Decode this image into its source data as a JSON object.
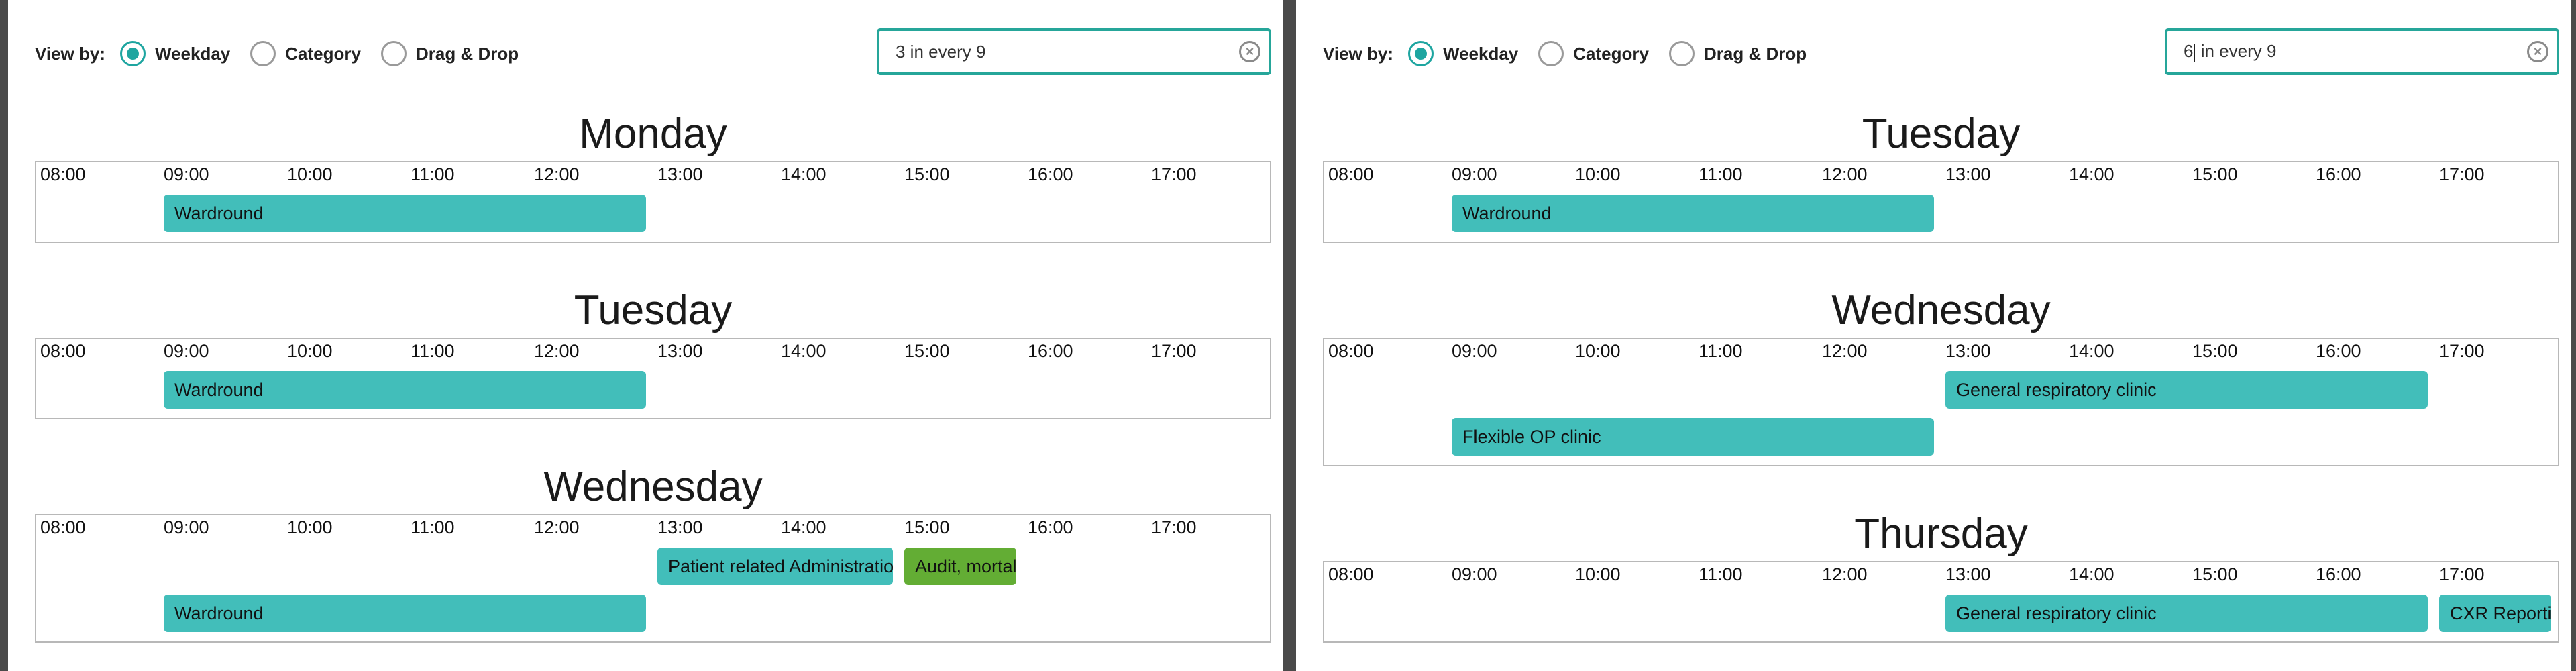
{
  "panels": [
    {
      "view_by_label": "View by:",
      "view_options": [
        "Weekday",
        "Category",
        "Drag & Drop"
      ],
      "search_value": "3 in every 9",
      "clear_icon": "clear-icon",
      "hours": [
        "08:00",
        "09:00",
        "10:00",
        "11:00",
        "12:00",
        "13:00",
        "14:00",
        "15:00",
        "16:00",
        "17:00"
      ],
      "days": [
        {
          "name": "Monday",
          "events": [
            {
              "label": "Wardround",
              "start": "09:00",
              "end": "12:55",
              "row": 0,
              "color": "#42beba"
            }
          ]
        },
        {
          "name": "Tuesday",
          "events": [
            {
              "label": "Wardround",
              "start": "09:00",
              "end": "12:55",
              "row": 0,
              "color": "#42beba"
            }
          ]
        },
        {
          "name": "Wednesday",
          "events": [
            {
              "label": "Patient related Administration",
              "start": "13:00",
              "end": "14:55",
              "row": 0,
              "color": "#42beba"
            },
            {
              "label": "Audit, mortality",
              "start": "15:00",
              "end": "15:55",
              "row": 0,
              "color": "#63ad34"
            },
            {
              "label": "Wardround",
              "start": "09:00",
              "end": "12:55",
              "row": 1,
              "color": "#42beba"
            }
          ]
        }
      ]
    },
    {
      "view_by_label": "View by:",
      "view_options": [
        "Weekday",
        "Category",
        "Drag & Drop"
      ],
      "search_value_before_caret": "6",
      "search_value_after_caret": " in every 9",
      "clear_icon": "clear-icon",
      "hours": [
        "08:00",
        "09:00",
        "10:00",
        "11:00",
        "12:00",
        "13:00",
        "14:00",
        "15:00",
        "16:00",
        "17:00"
      ],
      "days": [
        {
          "name": "Tuesday",
          "events": [
            {
              "label": "Wardround",
              "start": "09:00",
              "end": "12:55",
              "row": 0,
              "color": "#42beba"
            }
          ]
        },
        {
          "name": "Wednesday",
          "events": [
            {
              "label": "General respiratory clinic",
              "start": "13:00",
              "end": "16:55",
              "row": 0,
              "color": "#42beba"
            },
            {
              "label": "Flexible OP clinic",
              "start": "09:00",
              "end": "12:55",
              "row": 1,
              "color": "#42beba"
            }
          ]
        },
        {
          "name": "Thursday",
          "events": [
            {
              "label": "General respiratory clinic",
              "start": "13:00",
              "end": "16:55",
              "row": 0,
              "color": "#42beba"
            },
            {
              "label": "CXR Reporting",
              "start": "17:00",
              "end": "17:55",
              "row": 0,
              "color": "#42beba"
            }
          ]
        }
      ]
    }
  ]
}
